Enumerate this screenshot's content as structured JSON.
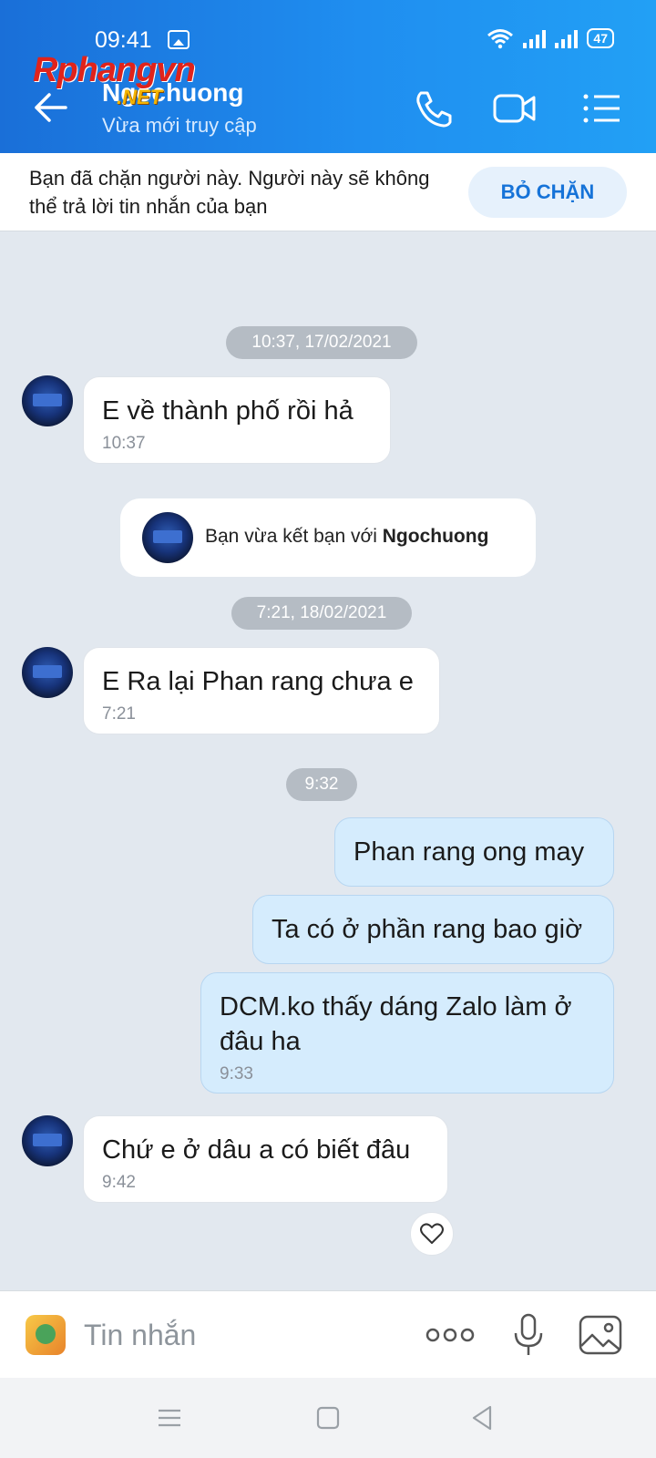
{
  "status_bar": {
    "time": "09:41",
    "battery": "47"
  },
  "header": {
    "contact_name": "Ngochuong",
    "contact_status": "Vừa mới truy cập",
    "watermark": "Rphangvn",
    "watermark_suffix": ".NET"
  },
  "block_banner": {
    "text": "Bạn đã chặn người này. Người này sẽ không thể trả lời tin nhắn của bạn",
    "unblock_label": "BỎ CHẶN"
  },
  "chat": {
    "date_chip_1": "10:37, 17/02/2021",
    "msg_1": {
      "text": "E về thành phố rồi hả",
      "time": "10:37"
    },
    "friend_notice": {
      "prefix": "Bạn vừa kết bạn với ",
      "name": "Ngochuong"
    },
    "date_chip_2": "7:21, 18/02/2021",
    "msg_2": {
      "text": "E Ra lại Phan rang chưa e",
      "time": "7:21"
    },
    "date_chip_3": "9:32",
    "msg_3": {
      "text": "Phan rang ong may"
    },
    "msg_4": {
      "text": "Ta có ở phần rang bao giờ"
    },
    "msg_5": {
      "text": "DCM.ko thấy dáng Zalo làm ở đâu ha",
      "time": "9:33"
    },
    "msg_6": {
      "text": "Chứ e ở dâu a có biết đâu",
      "time": "9:42"
    }
  },
  "input_bar": {
    "placeholder": "Tin nhắn"
  },
  "colors": {
    "header_blue": "#1f8ef0",
    "outgoing_bubble": "#d5ecfd",
    "accent": "#1673d8"
  }
}
